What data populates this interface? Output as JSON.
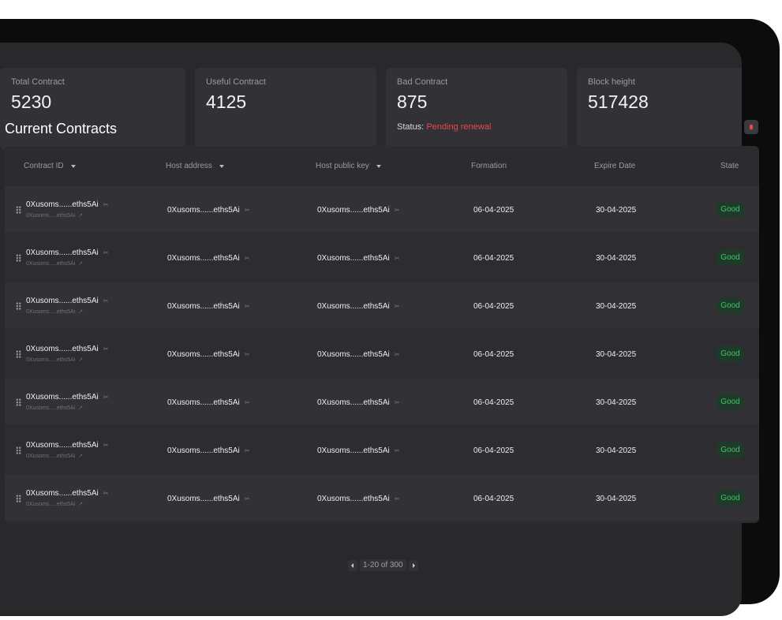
{
  "stats": {
    "total": {
      "label": "Total Contract",
      "value": "5230"
    },
    "useful": {
      "label": "Useful Contract",
      "value": "4125"
    },
    "bad": {
      "label": "Bad Contract",
      "value": "875",
      "status_label": "Status:",
      "status_value": "Pending renewal"
    },
    "block": {
      "label": "Block height",
      "value": "517428"
    }
  },
  "section_title": "Current  Contracts",
  "table": {
    "columns": [
      "Contract ID",
      "Host address",
      "Host public key",
      "Formation",
      "Expire Date",
      "State"
    ],
    "rows": [
      {
        "contract_id": "0Xusoms......eths5Ai",
        "contract_sub": "0Xusoms.....eths5Ai",
        "host_address": "0Xusoms......eths5Ai",
        "host_key": "0Xusoms......eths5Ai",
        "formation": "06-04-2025",
        "expire": "30-04-2025",
        "state": "Good"
      },
      {
        "contract_id": "0Xusoms......eths5Ai",
        "contract_sub": "0Xusoms.....eths5Ai",
        "host_address": "0Xusoms......eths5Ai",
        "host_key": "0Xusoms......eths5Ai",
        "formation": "06-04-2025",
        "expire": "30-04-2025",
        "state": "Good"
      },
      {
        "contract_id": "0Xusoms......eths5Ai",
        "contract_sub": "0Xusoms.....eths5Ai",
        "host_address": "0Xusoms......eths5Ai",
        "host_key": "0Xusoms......eths5Ai",
        "formation": "06-04-2025",
        "expire": "30-04-2025",
        "state": "Good"
      },
      {
        "contract_id": "0Xusoms......eths5Ai",
        "contract_sub": "0Xusoms.....eths5Ai",
        "host_address": "0Xusoms......eths5Ai",
        "host_key": "0Xusoms......eths5Ai",
        "formation": "06-04-2025",
        "expire": "30-04-2025",
        "state": "Good"
      },
      {
        "contract_id": "0Xusoms......eths5Ai",
        "contract_sub": "0Xusoms.....eths5Ai",
        "host_address": "0Xusoms......eths5Ai",
        "host_key": "0Xusoms......eths5Ai",
        "formation": "06-04-2025",
        "expire": "30-04-2025",
        "state": "Good"
      },
      {
        "contract_id": "0Xusoms......eths5Ai",
        "contract_sub": "0Xusoms.....eths5Ai",
        "host_address": "0Xusoms......eths5Ai",
        "host_key": "0Xusoms......eths5Ai",
        "formation": "06-04-2025",
        "expire": "30-04-2025",
        "state": "Good"
      },
      {
        "contract_id": "0Xusoms......eths5Ai",
        "contract_sub": "0Xusoms.....eths5Ai",
        "host_address": "0Xusoms......eths5Ai",
        "host_key": "0Xusoms......eths5Ai",
        "formation": "06-04-2025",
        "expire": "30-04-2025",
        "state": "Good"
      }
    ]
  },
  "pagination": {
    "label": "1-20 of 300"
  },
  "colors": {
    "good": "#3ec46d",
    "danger": "#e5484d",
    "background": "#29292c"
  },
  "icons": {
    "copy": "link-icon",
    "external": "external-link-icon",
    "drag": "drag-handle-icon"
  }
}
